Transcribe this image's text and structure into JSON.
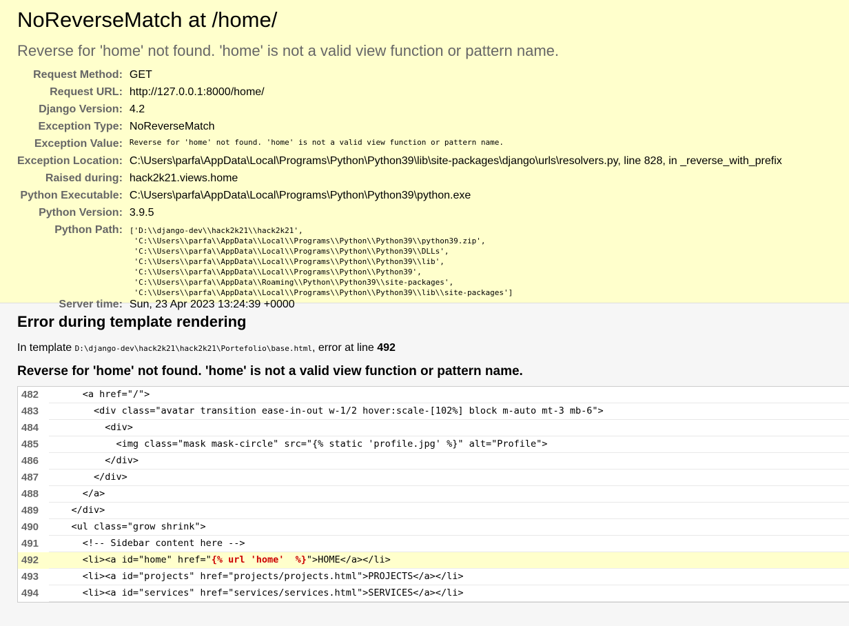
{
  "title": "NoReverseMatch at /home/",
  "subtitle": "Reverse for 'home' not found. 'home' is not a valid view function or pattern name.",
  "meta": [
    {
      "label": "Request Method:",
      "value": "GET"
    },
    {
      "label": "Request URL:",
      "value": "http://127.0.0.1:8000/home/"
    },
    {
      "label": "Django Version:",
      "value": "4.2"
    },
    {
      "label": "Exception Type:",
      "value": "NoReverseMatch"
    },
    {
      "label": "Exception Value:",
      "value": "Reverse for 'home' not found. 'home' is not a valid view function or pattern name."
    },
    {
      "label": "Exception Location:",
      "value": "C:\\Users\\parfa\\AppData\\Local\\Programs\\Python\\Python39\\lib\\site-packages\\django\\urls\\resolvers.py, line 828, in _reverse_with_prefix"
    },
    {
      "label": "Raised during:",
      "value": "hack2k21.views.home"
    },
    {
      "label": "Python Executable:",
      "value": "C:\\Users\\parfa\\AppData\\Local\\Programs\\Python\\Python39\\python.exe"
    },
    {
      "label": "Python Version:",
      "value": "3.9.5"
    },
    {
      "label": "Python Path:",
      "value": "['D:\\\\django-dev\\\\hack2k21\\\\hack2k21',\n 'C:\\\\Users\\\\parfa\\\\AppData\\\\Local\\\\Programs\\\\Python\\\\Python39\\\\python39.zip',\n 'C:\\\\Users\\\\parfa\\\\AppData\\\\Local\\\\Programs\\\\Python\\\\Python39\\\\DLLs',\n 'C:\\\\Users\\\\parfa\\\\AppData\\\\Local\\\\Programs\\\\Python\\\\Python39\\\\lib',\n 'C:\\\\Users\\\\parfa\\\\AppData\\\\Local\\\\Programs\\\\Python\\\\Python39',\n 'C:\\\\Users\\\\parfa\\\\AppData\\\\Roaming\\\\Python\\\\Python39\\\\site-packages',\n 'C:\\\\Users\\\\parfa\\\\AppData\\\\Local\\\\Programs\\\\Python\\\\Python39\\\\lib\\\\site-packages']"
    },
    {
      "label": "Server time:",
      "value": "Sun, 23 Apr 2023 13:24:39 +0000"
    }
  ],
  "template": {
    "heading": "Error during template rendering",
    "in_template": "In template",
    "file": "D:\\django-dev\\hack2k21\\hack2k21\\Portefolio\\base.html",
    "error_at": ", error at line",
    "line": "492",
    "message": "Reverse for 'home' not found. 'home' is not a valid view function or pattern name.",
    "lines": [
      {
        "num": "482",
        "code": "      <a href=\"/\">"
      },
      {
        "num": "483",
        "code": "        <div class=\"avatar transition ease-in-out w-1/2 hover:scale-[102%] block m-auto mt-3 mb-6\">"
      },
      {
        "num": "484",
        "code": "          <div>"
      },
      {
        "num": "485",
        "code": "            <img class=\"mask mask-circle\" src=\"{% static 'profile.jpg' %}\" alt=\"Profile\">"
      },
      {
        "num": "486",
        "code": "          </div>"
      },
      {
        "num": "487",
        "code": "        </div>"
      },
      {
        "num": "488",
        "code": "      </a>"
      },
      {
        "num": "489",
        "code": "    </div>"
      },
      {
        "num": "490",
        "code": "    <ul class=\"grow shrink\">"
      },
      {
        "num": "491",
        "code": "      <!-- Sidebar content here -->"
      },
      {
        "num": "492",
        "before": "      <li><a id=\"home\" href=\"",
        "highlight": "{% url 'home'  %}",
        "after": "\">HOME</a></li>",
        "error": true
      },
      {
        "num": "493",
        "code": "      <li><a id=\"projects\" href=\"projects/projects.html\">PROJECTS</a></li>"
      },
      {
        "num": "494",
        "code": "      <li><a id=\"services\" href=\"services/services.html\">SERVICES</a></li>"
      }
    ]
  }
}
